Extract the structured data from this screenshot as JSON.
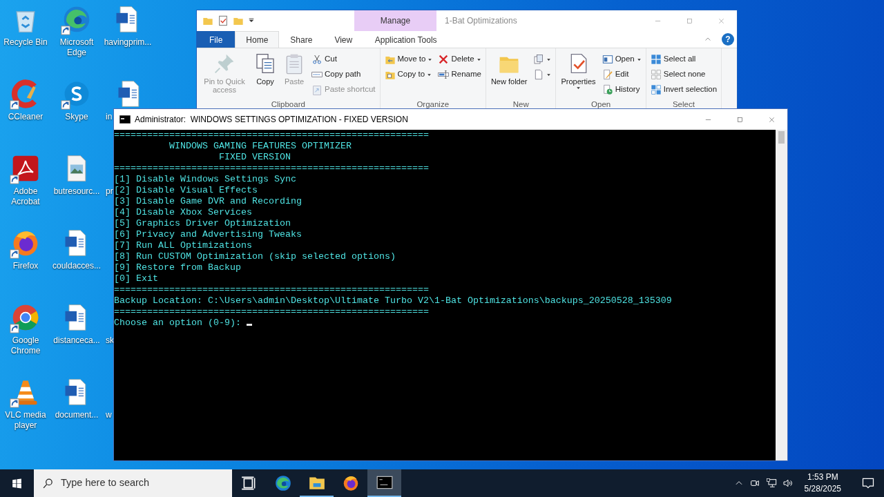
{
  "desktop": {
    "columns": [
      [
        {
          "kind": "recycle",
          "label": "Recycle Bin",
          "shortcut": false
        },
        {
          "kind": "ccleaner",
          "label": "CCleaner",
          "shortcut": true
        },
        {
          "kind": "acrobat",
          "label": "Adobe Acrobat",
          "shortcut": true
        },
        {
          "kind": "firefox",
          "label": "Firefox",
          "shortcut": true
        },
        {
          "kind": "chrome",
          "label": "Google Chrome",
          "shortcut": true
        },
        {
          "kind": "vlc",
          "label": "VLC media player",
          "shortcut": true
        }
      ],
      [
        {
          "kind": "edge",
          "label": "Microsoft Edge",
          "shortcut": true
        },
        {
          "kind": "skype",
          "label": "Skype",
          "shortcut": true
        },
        {
          "kind": "image",
          "label": "butresourc...",
          "shortcut": false
        },
        {
          "kind": "word",
          "label": "couldacces...",
          "shortcut": false
        },
        {
          "kind": "word",
          "label": "distanceca...",
          "shortcut": false
        },
        {
          "kind": "word",
          "label": "document...",
          "shortcut": false
        }
      ],
      [
        {
          "kind": "word",
          "label": "havingprim...",
          "shortcut": false
        },
        {
          "kind": "word",
          "label": "in",
          "cut": true
        },
        {
          "kind": "covered",
          "label": "pr",
          "cut": true
        },
        {
          "kind": "covered"
        },
        {
          "kind": "covered",
          "label": "sk",
          "cut": true
        },
        {
          "kind": "covered",
          "label": "w",
          "cut": true
        }
      ]
    ]
  },
  "explorer": {
    "title": "1-Bat Optimizations",
    "context_header": "Manage",
    "help": "?",
    "tabs": [
      {
        "label": "File",
        "kind": "file",
        "selected": false
      },
      {
        "label": "Home",
        "selected": true
      },
      {
        "label": "Share",
        "selected": false
      },
      {
        "label": "View",
        "selected": false
      },
      {
        "label": "Application Tools",
        "kind": "context",
        "selected": false
      }
    ],
    "groups": [
      {
        "label": "Clipboard",
        "items": [
          {
            "kind": "pin",
            "label": "Pin to Quick access",
            "disabled": true
          },
          {
            "kind": "copy",
            "label": "Copy",
            "disabled": false
          },
          {
            "kind": "paste",
            "label": "Paste",
            "disabled": true
          },
          {
            "kind": "stack",
            "commands": [
              {
                "kind": "cut",
                "label": "Cut",
                "disabled": false
              },
              {
                "kind": "copypath",
                "label": "Copy path",
                "disabled": false
              },
              {
                "kind": "pasteshortcut",
                "label": "Paste shortcut",
                "disabled": true
              }
            ]
          }
        ]
      },
      {
        "label": "Organize",
        "items": [
          {
            "kind": "stack",
            "commands": [
              {
                "kind": "moveto",
                "label": "Move to",
                "dropdown": true,
                "disabled": false
              },
              {
                "kind": "copyto",
                "label": "Copy to",
                "dropdown": true,
                "disabled": false
              }
            ]
          },
          {
            "kind": "stack",
            "commands": [
              {
                "kind": "delete",
                "label": "Delete",
                "dropdown": true,
                "disabled": false
              },
              {
                "kind": "rename",
                "label": "Rename",
                "disabled": false
              }
            ]
          }
        ]
      },
      {
        "label": "New",
        "items": [
          {
            "kind": "newfolder",
            "label": "New folder",
            "disabled": false
          },
          {
            "kind": "stack",
            "commands": [
              {
                "kind": "newitem",
                "dropdown": true,
                "disabled": false
              },
              {
                "kind": "easyaccess",
                "dropdown": true,
                "disabled": false
              }
            ]
          }
        ]
      },
      {
        "label": "Open",
        "items": [
          {
            "kind": "properties",
            "label": "Properties",
            "dropdown": true,
            "disabled": false
          },
          {
            "kind": "stack",
            "commands": [
              {
                "kind": "open",
                "label": "Open",
                "dropdown": true,
                "disabled": false
              },
              {
                "kind": "edit",
                "label": "Edit",
                "disabled": false
              },
              {
                "kind": "history",
                "label": "History",
                "disabled": false
              }
            ]
          }
        ]
      },
      {
        "label": "Select",
        "items": [
          {
            "kind": "stack",
            "commands": [
              {
                "kind": "selectall",
                "label": "Select all",
                "disabled": false
              },
              {
                "kind": "selectnone",
                "label": "Select none",
                "disabled": false
              },
              {
                "kind": "invert",
                "label": "Invert selection",
                "disabled": false
              }
            ]
          }
        ]
      }
    ]
  },
  "console": {
    "title": "Administrator:  WINDOWS SETTINGS OPTIMIZATION - FIXED VERSION",
    "lines": [
      "=========================================================",
      "          WINDOWS GAMING FEATURES OPTIMIZER",
      "                   FIXED VERSION",
      "=========================================================",
      "[1] Disable Windows Settings Sync",
      "[2] Disable Visual Effects",
      "[3] Disable Game DVR and Recording",
      "[4] Disable Xbox Services",
      "[5] Graphics Driver Optimization",
      "[6] Privacy and Advertising Tweaks",
      "[7] Run ALL Optimizations",
      "[8] Run CUSTOM Optimization (skip selected options)",
      "[9] Restore from Backup",
      "[0] Exit",
      "=========================================================",
      "Backup Location: C:\\Users\\admin\\Desktop\\Ultimate Turbo V2\\1-Bat Optimizations\\backups_20250528_135309",
      "========================================================="
    ],
    "prompt": "Choose an option (0-9): "
  },
  "taskbar": {
    "search": {
      "placeholder": "Type here to search"
    },
    "apps": [
      {
        "kind": "taskview",
        "running": false,
        "active": false
      },
      {
        "kind": "edge",
        "running": false,
        "active": false
      },
      {
        "kind": "explorer",
        "running": true,
        "active": false
      },
      {
        "kind": "firefox",
        "running": false,
        "active": false
      },
      {
        "kind": "console",
        "running": true,
        "active": true
      }
    ],
    "time": "1:53 PM",
    "date": "5/28/2025"
  }
}
